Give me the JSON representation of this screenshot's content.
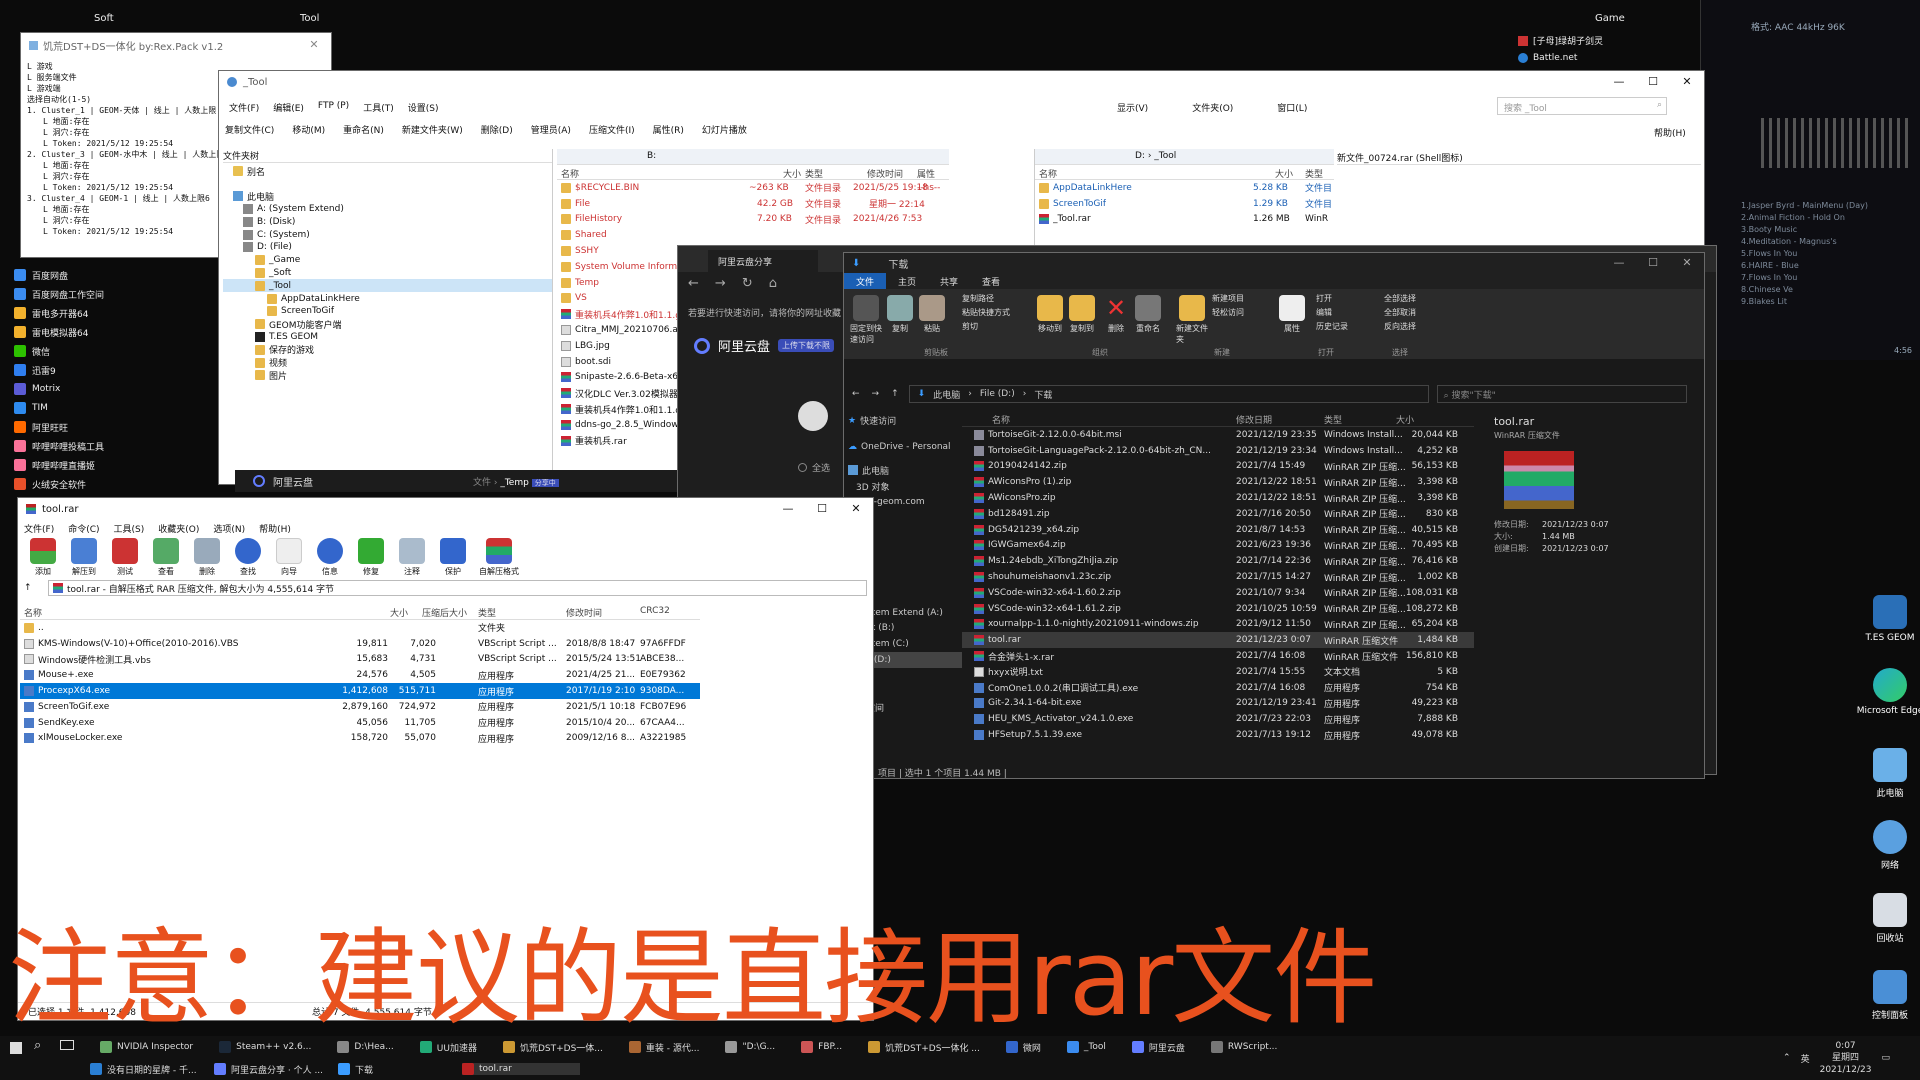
{
  "desktop": {
    "labels": {
      "soft": "Soft",
      "tool": "Tool",
      "game": "Game"
    },
    "icons": [
      "百度网盘",
      "百度网盘工作空间",
      "雷电多开器64",
      "雷电模拟器64",
      "微信",
      "迅雷9",
      "Motrix",
      "TIM",
      "阿里旺旺",
      "哔哩哔哩投稿工具",
      "哔哩哔哩直播姬",
      "火绒安全软件"
    ],
    "right_icons": [
      "T.ES GEOM",
      "Microsoft Edge",
      "此电脑",
      "网络",
      "回收站",
      "控制面板"
    ],
    "top_right_items": [
      "[子母]绿胡子剑灵",
      "Battle.net"
    ],
    "music_lines": [
      "格式: AAC 44kHz 96K",
      "1.Jasper Byrd - MainMenu (Day)",
      "2.Animal Fiction - Hold On",
      "3.Booty Music",
      "4.Meditation - Magnus's",
      "5.Flows In You",
      "6.HAIRE - Blue",
      "7.Flows In You",
      "8.Chinese Ve",
      "9.Blakes Lit",
      "4:56"
    ]
  },
  "editor": {
    "title": "饥荒DST+DS一体化 by:Rex.Pack v1.2",
    "lines": [
      "L 游戏",
      "L 服务端文件",
      "L 游戏端",
      "选择自动化(1-5)",
      "1. Cluster_1 | GEOM-天体 | 线上 | 人数上限",
      "L 地面:存在",
      "L 洞穴:存在",
      "L Token: 2021/5/12 19:25:54",
      "2. Cluster_3 | GEOM-水中木 | 线上 | 人数上限",
      "L 地面:存在",
      "L 洞穴:存在",
      "L Token: 2021/5/12 19:25:54",
      "3. Cluster_4 | GEOM-1 | 线上 | 人数上限6",
      "L 地面:存在",
      "L 洞穴:存在",
      "L Token: 2021/5/12 19:25:54"
    ]
  },
  "tool_window": {
    "title": "_Tool",
    "menu": [
      "文件(F)",
      "编辑(E)",
      "FTP (P)",
      "工具(T)",
      "设置(S)"
    ],
    "menu_right": [
      "显示(V)",
      "文件夹(O)",
      "窗口(L)",
      "帮助(H)"
    ],
    "search_placeholder": "搜索 _Tool",
    "toolbar": [
      "复制文件(C)",
      "移动(M)",
      "重命名(N)",
      "新建文件夹(W)",
      "删除(D)",
      "管理员(A)",
      "压缩文件(I)",
      "属性(R)",
      "幻灯片播放"
    ],
    "tree_header": "文件夹树",
    "tree": [
      "别名",
      "此电脑",
      "A: (System Extend)",
      "B: (Disk)",
      "C: (System)",
      "D: (File)",
      "_Game",
      "_Soft",
      "_Tool",
      "AppDataLinkHere",
      "ScreenToGif",
      "GEOM功能客户端",
      "T.ES GEOM",
      "保存的游戏",
      "视频",
      "图片"
    ],
    "pane1": {
      "path": "B:",
      "headers": [
        "名称",
        "大小",
        "类型",
        "修改时间",
        "属性"
      ],
      "rows": [
        [
          "$RECYCLE.BIN",
          "~263 KB",
          "文件目录",
          "2021/5/25 19:18",
          "--hs--"
        ],
        [
          "File",
          "42.2 GB",
          "文件目录",
          "星期一 22:14",
          ""
        ],
        [
          "FileHistory",
          "7.20 KB",
          "文件目录",
          "2021/4/26 7:53",
          ""
        ],
        [
          "Shared",
          "",
          "",
          "",
          ""
        ],
        [
          "SSHY",
          "",
          "",
          "",
          ""
        ],
        [
          "System Volume Inform",
          "",
          "",
          "",
          ""
        ],
        [
          "Temp",
          "",
          "",
          "",
          ""
        ],
        [
          "VS",
          "",
          "",
          "",
          ""
        ],
        [
          "重装机兵4作弊1.0和1.1.g",
          "",
          "",
          "",
          ""
        ],
        [
          "Citra_MMJ_20210706.a",
          "",
          "",
          "",
          ""
        ],
        [
          "LBG.jpg",
          "",
          "",
          "",
          ""
        ],
        [
          "boot.sdi",
          "",
          "",
          "",
          ""
        ],
        [
          "Snipaste-2.6.6-Beta-x6",
          "",
          "",
          "",
          ""
        ],
        [
          "汉化DLC Ver.3.02模拟器",
          "",
          "",
          "",
          ""
        ],
        [
          "重装机兵4作弊1.0和1.1.d",
          "",
          "",
          "",
          ""
        ],
        [
          "ddns-go_2.8.5_Window",
          "",
          "",
          "",
          ""
        ],
        [
          "重装机兵.rar",
          "",
          "",
          "",
          ""
        ]
      ]
    },
    "pane2": {
      "path": "D: › _Tool",
      "headers": [
        "名称",
        "大小",
        "类型"
      ],
      "rows": [
        [
          "AppDataLinkHere",
          "5.28 KB",
          "文件目"
        ],
        [
          "ScreenToGif",
          "1.29 KB",
          "文件目"
        ],
        [
          "_Tool.rar",
          "1.26 MB",
          "WinR"
        ]
      ]
    },
    "preview_title": "新文件_00724.rar (Shell图标)"
  },
  "aliyun": {
    "tab_title": "阿里云盘分享",
    "notice": "若要进行快速访问，请将你的网址收藏",
    "brand": "阿里云盘",
    "badge": "上传下载不限",
    "breadcrumb": [
      "文件",
      "_Temp",
      "分享中"
    ],
    "select_all": "全选"
  },
  "explorer": {
    "title": "下载",
    "tabs": [
      "文件",
      "主页",
      "共享",
      "查看"
    ],
    "ribbon_groups": [
      "剪贴板",
      "组织",
      "新建",
      "打开",
      "选择"
    ],
    "ribbon": {
      "pin": "固定到快速访问",
      "copy": "复制",
      "paste": "粘贴",
      "copy_path": "复制路径",
      "paste_shortcut": "粘贴快捷方式",
      "cut": "剪切",
      "move_to": "移动到",
      "copy_to": "复制到",
      "delete": "删除",
      "rename": "重命名",
      "new_folder": "新建文件夹",
      "new_item": "新建项目",
      "easy_access": "轻松访问",
      "properties": "属性",
      "open": "打开",
      "edit": "编辑",
      "history": "历史记录",
      "select_all": "全部选择",
      "select_none": "全部取消",
      "invert": "反向选择"
    },
    "path": [
      "此电脑",
      "File (D:)",
      "下载"
    ],
    "search_placeholder": "搜索\"下载\"",
    "nav": [
      "快速访问",
      "OneDrive - Personal",
      "此电脑",
      "3D 对象",
      "s.es-geom.com",
      "视频",
      "图片",
      "文档",
      "下载",
      "音乐",
      "桌面",
      "System Extend (A:)",
      "Disk (B:)",
      "System (C:)",
      "File (D:)",
      "网络",
      "工作空间"
    ],
    "headers": [
      "名称",
      "修改日期",
      "类型",
      "大小"
    ],
    "rows": [
      [
        "TortoiseGit-2.12.0.0-64bit.msi",
        "2021/12/19 23:35",
        "Windows Install...",
        "20,044 KB",
        "msi"
      ],
      [
        "TortoiseGit-LanguagePack-2.12.0.0-64bit-zh_CN...",
        "2021/12/19 23:34",
        "Windows Install...",
        "4,252 KB",
        "msi"
      ],
      [
        "20190424142.zip",
        "2021/7/4 15:49",
        "WinRAR ZIP 压缩...",
        "56,153 KB",
        "zip"
      ],
      [
        "AWiconsPro (1).zip",
        "2021/12/22 18:51",
        "WinRAR ZIP 压缩...",
        "3,398 KB",
        "zip"
      ],
      [
        "AWiconsPro.zip",
        "2021/12/22 18:51",
        "WinRAR ZIP 压缩...",
        "3,398 KB",
        "zip"
      ],
      [
        "bd128491.zip",
        "2021/7/16 20:50",
        "WinRAR ZIP 压缩...",
        "830 KB",
        "zip"
      ],
      [
        "DG5421239_x64.zip",
        "2021/8/7 14:53",
        "WinRAR ZIP 压缩...",
        "40,515 KB",
        "zip"
      ],
      [
        "IGWGamex64.zip",
        "2021/6/23 19:36",
        "WinRAR ZIP 压缩...",
        "70,495 KB",
        "zip"
      ],
      [
        "Ms1.24ebdb_XiTongZhiJia.zip",
        "2021/7/14 22:36",
        "WinRAR ZIP 压缩...",
        "76,416 KB",
        "zip"
      ],
      [
        "shouhumeishaonv1.23c.zip",
        "2021/7/15 14:27",
        "WinRAR ZIP 压缩...",
        "1,002 KB",
        "zip"
      ],
      [
        "VSCode-win32-x64-1.60.2.zip",
        "2021/10/7 9:34",
        "WinRAR ZIP 压缩...",
        "108,031 KB",
        "zip"
      ],
      [
        "VSCode-win32-x64-1.61.2.zip",
        "2021/10/25 10:59",
        "WinRAR ZIP 压缩...",
        "108,272 KB",
        "zip"
      ],
      [
        "xournalpp-1.1.0-nightly.20210911-windows.zip",
        "2021/9/12 11:50",
        "WinRAR ZIP 压缩...",
        "65,204 KB",
        "zip"
      ],
      [
        "tool.rar",
        "2021/12/23 0:07",
        "WinRAR 压缩文件",
        "1,484 KB",
        "zip"
      ],
      [
        "合金弹头1-x.rar",
        "2021/7/4 16:08",
        "WinRAR 压缩文件",
        "156,810 KB",
        "zip"
      ],
      [
        "hxyx说明.txt",
        "2021/7/4 15:55",
        "文本文档",
        "5 KB",
        "doc"
      ],
      [
        "ComOne1.0.0.2(串口调试工具).exe",
        "2021/7/4 16:08",
        "应用程序",
        "754 KB",
        "exe"
      ],
      [
        "Git-2.34.1-64-bit.exe",
        "2021/12/19 23:41",
        "应用程序",
        "49,223 KB",
        "exe"
      ],
      [
        "HEU_KMS_Activator_v24.1.0.exe",
        "2021/7/23 22:03",
        "应用程序",
        "7,888 KB",
        "exe"
      ],
      [
        "HFSetup7.5.1.39.exe",
        "2021/7/13 19:12",
        "应用程序",
        "49,078 KB",
        "exe"
      ]
    ],
    "details": {
      "name": "tool.rar",
      "type": "WinRAR 压缩文件",
      "fields": [
        [
          "修改日期:",
          "2021/12/23 0:07"
        ],
        [
          "大小:",
          "1.44 MB"
        ],
        [
          "创建日期:",
          "2021/12/23 0:07"
        ]
      ]
    },
    "status": "项目 | 选中 1 个项目 1.44 MB |"
  },
  "winrar": {
    "title": "tool.rar",
    "menu": [
      "文件(F)",
      "命令(C)",
      "工具(S)",
      "收藏夹(O)",
      "选项(N)",
      "帮助(H)"
    ],
    "toolbar": [
      "添加",
      "解压到",
      "测试",
      "查看",
      "删除",
      "查找",
      "向导",
      "信息",
      "修复",
      "注释",
      "保护",
      "自解压格式"
    ],
    "path": "tool.rar - 自解压格式 RAR 压缩文件, 解包大小为 4,555,614 字节",
    "headers": [
      "名称",
      "大小",
      "压缩后大小",
      "类型",
      "修改时间",
      "CRC32"
    ],
    "rows": [
      [
        "..",
        "",
        "",
        "文件夹",
        "",
        ""
      ],
      [
        "KMS-Windows(V-10)+Office(2010-2016).VBS",
        "19,811",
        "7,020",
        "VBScript Script ...",
        "2018/8/8 18:47",
        "97A6FFDF"
      ],
      [
        "Windows硬件检测工具.vbs",
        "15,683",
        "4,731",
        "VBScript Script ...",
        "2015/5/24 13:51",
        "ABCE38..."
      ],
      [
        "Mouse+.exe",
        "24,576",
        "4,505",
        "应用程序",
        "2021/4/25 21...",
        "E0E79362"
      ],
      [
        "ProcexpX64.exe",
        "1,412,608",
        "515,711",
        "应用程序",
        "2017/1/19 2:10",
        "9308DA..."
      ],
      [
        "ScreenToGif.exe",
        "2,879,160",
        "724,972",
        "应用程序",
        "2021/5/1 10:18",
        "FCB07E96"
      ],
      [
        "SendKey.exe",
        "45,056",
        "11,705",
        "应用程序",
        "2015/10/4 20...",
        "67CAA4..."
      ],
      [
        "xlMouseLocker.exe",
        "158,720",
        "55,070",
        "应用程序",
        "2009/12/16 8...",
        "A3221985"
      ]
    ],
    "status_left": "已选择 1 文件, 1,412,608",
    "status_right": "总计 7 文件, 4,555,614 字节"
  },
  "overlay_text": "注意：建议的是直接用rar文件",
  "taskbar": {
    "row1": [
      "NVIDIA Inspector",
      "Steam++ v2.6...",
      "D:\\Hea...",
      "UU加速器",
      "饥荒DST+DS一体...",
      "重装 - 源代...",
      "\"D:\\G...",
      "FBP...",
      "饥荒DST+DS一体化 ...",
      "微网",
      "_Tool",
      "阿里云盘",
      "RWScript..."
    ],
    "row2": [
      "没有日期的星牌 - 千...",
      "阿里云盘分享 · 个人 ...",
      "下载",
      "tool.rar"
    ],
    "tray_lang": "英",
    "time": "0:07",
    "weekday": "星期四",
    "date": "2021/12/23"
  }
}
